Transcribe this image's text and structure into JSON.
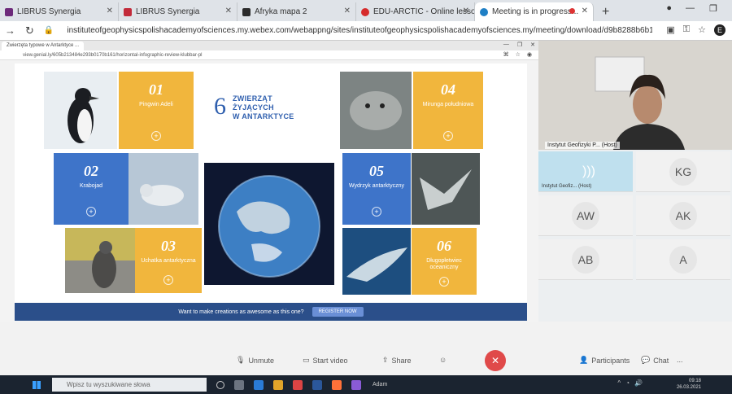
{
  "browser": {
    "tabs": [
      {
        "label": "LIBRUS Synergia",
        "fav_color": "#6d2a7a",
        "active": false
      },
      {
        "label": "LIBRUS Synergia",
        "fav_color": "#c22a3a",
        "active": false
      },
      {
        "label": "Afryka mapa 2",
        "fav_color": "#2c2c2c",
        "active": false
      },
      {
        "label": "EDU-ARCTIC - Online lesson",
        "fav_color": "#d62b2b",
        "active": false
      },
      {
        "label": "Meeting is in progress...",
        "fav_color": "#1f7fc5",
        "active": true
      }
    ],
    "new_tab": "+",
    "url": "instituteofgeophysicspolishacademyofsciences.my.webex.com/webappng/sites/instituteofgeophysicspolishacademyofsciences.my/meeting/download/d9b8288b6b124...",
    "profile_initial": "E"
  },
  "shared": {
    "inner_tab": "Zwierzęta typowe w Antarktyce ...",
    "inner_url": "view.genial.ly/605b213484e293b0170b161/horizontal-infographic-review-klubbar-pl",
    "title_number": "6",
    "title_lines": [
      "ZWIERZĄT",
      "ŻYJĄCYCH",
      "W ANTARKTYCE"
    ],
    "tiles": [
      {
        "num": "01",
        "label": "Pingwin Adeli"
      },
      {
        "num": "02",
        "label": "Krabojad"
      },
      {
        "num": "03",
        "label": "Uchatka antarktyczna"
      },
      {
        "num": "04",
        "label": "Mirunga południowa"
      },
      {
        "num": "05",
        "label": "Wydrzyk antarktyczny"
      },
      {
        "num": "06",
        "label": "Długopłetwiec oceaniczny"
      }
    ],
    "promo_text": "Want to make creations as awesome as this one?",
    "promo_button": "REGISTER NOW"
  },
  "controls": {
    "unmute": "Unmute",
    "start_video": "Start video",
    "share": "Share",
    "participants": "Participants",
    "chat": "Chat",
    "more": "..."
  },
  "participants": {
    "host_label": "Instytut Geofizyki P... (Host)",
    "active_label": "Instytut Geofiz... (Host)",
    "cells": [
      "KG",
      "AW",
      "AK",
      "AB",
      "A"
    ]
  },
  "taskbar": {
    "search_placeholder": "Wpisz tu wyszukiwane słowa",
    "clock_time": "09:18",
    "clock_date": "26.03.2021",
    "tray_label": "Adam"
  },
  "colors": {
    "tile_yellow": "#f1b63d",
    "tile_blue": "#3e74c9",
    "end_red": "#e04a4a",
    "promo_blue": "#2b4f8a"
  }
}
